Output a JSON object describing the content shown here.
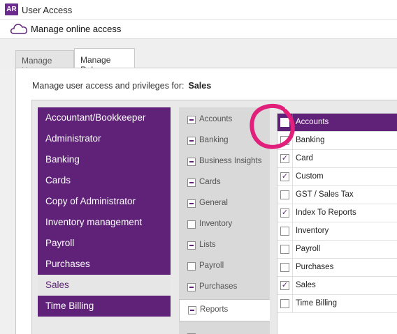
{
  "window": {
    "app_logo": "AR",
    "title": "User Access"
  },
  "header": {
    "title": "Manage online access",
    "icon": "cloud-icon"
  },
  "tabs": [
    {
      "label": "Manage Users",
      "active": false
    },
    {
      "label": "Manage Roles",
      "active": true
    }
  ],
  "manage": {
    "prefix": "Manage user access and privileges for:",
    "role_name": "Sales"
  },
  "roles": [
    {
      "label": "Accountant/Bookkeeper",
      "selected": false
    },
    {
      "label": "Administrator",
      "selected": false
    },
    {
      "label": "Banking",
      "selected": false
    },
    {
      "label": "Cards",
      "selected": false
    },
    {
      "label": "Copy of Administrator",
      "selected": false
    },
    {
      "label": "Inventory management",
      "selected": false
    },
    {
      "label": "Payroll",
      "selected": false
    },
    {
      "label": "Purchases",
      "selected": false
    },
    {
      "label": "Sales",
      "selected": true
    },
    {
      "label": "Time Billing",
      "selected": false
    }
  ],
  "categories": [
    {
      "label": "Accounts",
      "state": "partial"
    },
    {
      "label": "Banking",
      "state": "partial"
    },
    {
      "label": "Business Insights",
      "state": "partial"
    },
    {
      "label": "Cards",
      "state": "partial"
    },
    {
      "label": "General",
      "state": "partial"
    },
    {
      "label": "Inventory",
      "state": "unchecked"
    },
    {
      "label": "Lists",
      "state": "partial"
    },
    {
      "label": "Payroll",
      "state": "unchecked"
    },
    {
      "label": "Purchases",
      "state": "partial"
    },
    {
      "label": "Reports",
      "state": "partial",
      "active": true
    }
  ],
  "report_items": [
    {
      "label": "Accounts",
      "checked": false,
      "active": true
    },
    {
      "label": "Banking",
      "checked": false,
      "active": false
    },
    {
      "label": "Card",
      "checked": true,
      "active": false
    },
    {
      "label": "Custom",
      "checked": true,
      "active": false
    },
    {
      "label": "GST / Sales Tax",
      "checked": false,
      "active": false
    },
    {
      "label": "Index To Reports",
      "checked": true,
      "active": false
    },
    {
      "label": "Inventory",
      "checked": false,
      "active": false
    },
    {
      "label": "Payroll",
      "checked": false,
      "active": false
    },
    {
      "label": "Purchases",
      "checked": false,
      "active": false
    },
    {
      "label": "Sales",
      "checked": true,
      "active": false
    },
    {
      "label": "Time Billing",
      "checked": false,
      "active": false
    }
  ],
  "colors": {
    "accent": "#5f2278",
    "annotation": "#e0207a"
  }
}
